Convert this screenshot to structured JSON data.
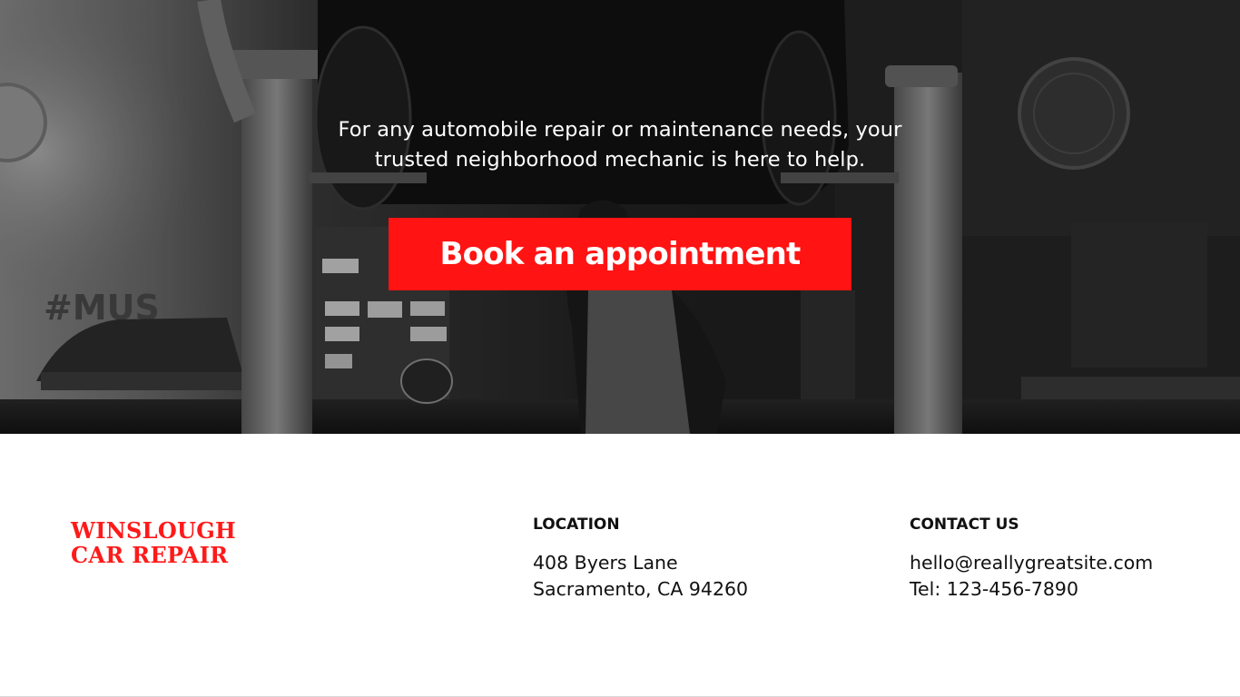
{
  "hero": {
    "tagline_line1": "For any automobile repair or maintenance needs, your",
    "tagline_line2": "trusted neighborhood mechanic is here to help.",
    "cta_label": "Book an appointment",
    "background_description_icon": "garage-photo",
    "cta_color": "#ff1313"
  },
  "brand": {
    "line1": "WINSLOUGH",
    "line2": "CAR REPAIR",
    "color": "#ff1a1a"
  },
  "location": {
    "heading": "LOCATION",
    "address_line1": "408 Byers Lane",
    "address_line2": "Sacramento, CA 94260"
  },
  "contact": {
    "heading": "CONTACT US",
    "email": "hello@reallygreatsite.com",
    "phone": "Tel: 123-456-7890"
  }
}
